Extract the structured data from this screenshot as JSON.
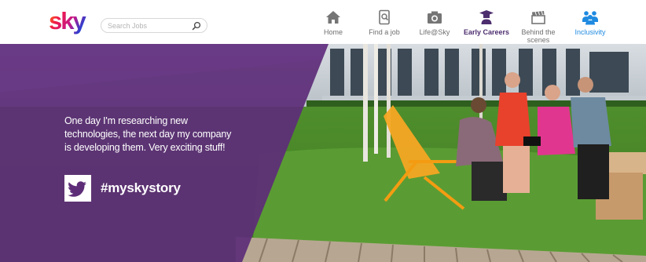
{
  "brand": {
    "logo_text": "sky"
  },
  "search": {
    "placeholder": "Search Jobs",
    "value": ""
  },
  "nav": {
    "home": {
      "label": "Home",
      "icon": "home-icon"
    },
    "find_job": {
      "label": "Find a job",
      "icon": "find-job-icon"
    },
    "life": {
      "label": "Life@Sky",
      "icon": "camera-icon"
    },
    "early_careers": {
      "label": "Early Careers",
      "icon": "graduate-icon",
      "active": true
    },
    "behind": {
      "label_line1": "Behind the",
      "label_line2": "scenes",
      "icon": "clapperboard-icon"
    },
    "inclusivity": {
      "label": "Inclusivity",
      "icon": "people-icon"
    }
  },
  "hero": {
    "quote": "One day I'm researching new technologies, the next day my company is developing them. Very exciting stuff!",
    "hashtag": "#myskystory",
    "social_icon": "twitter-icon"
  },
  "colors": {
    "overlay_purple": "#5e2d78",
    "active_nav": "#4c2d6e",
    "inclusivity_blue": "#1f8ae0",
    "nav_grey": "#6f6f6f"
  }
}
